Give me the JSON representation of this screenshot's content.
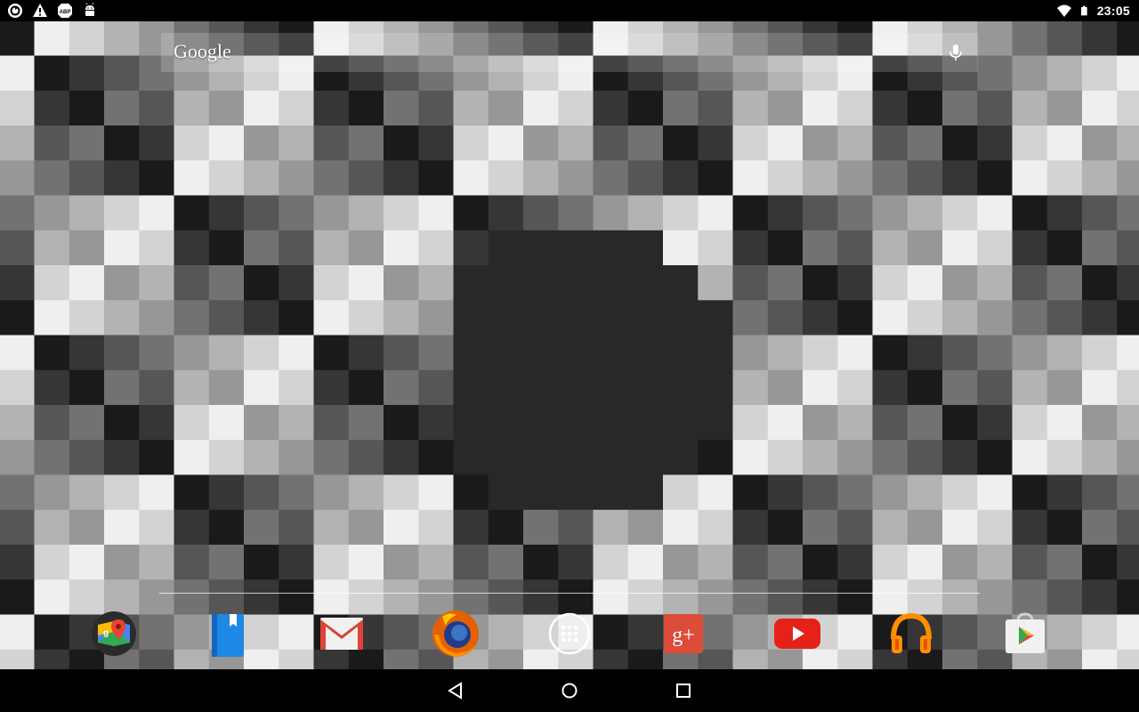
{
  "status_bar": {
    "time": "23:05",
    "left_icons": [
      "sync-icon",
      "warning-icon",
      "adblock-icon",
      "android-debug-icon"
    ],
    "right_icons": [
      "wifi-icon",
      "battery-icon"
    ]
  },
  "search_bar": {
    "logo_text": "Google",
    "icon": "mic-icon"
  },
  "dock": {
    "apps": [
      {
        "name": "Maps",
        "icon": "maps-icon"
      },
      {
        "name": "Play Books",
        "icon": "books-icon"
      },
      {
        "name": "Gmail",
        "icon": "gmail-icon"
      },
      {
        "name": "Firefox",
        "icon": "firefox-icon"
      },
      {
        "name": "All Apps",
        "icon": "app-drawer-icon"
      },
      {
        "name": "Google+",
        "icon": "google-plus-icon",
        "label": "g+"
      },
      {
        "name": "YouTube",
        "icon": "youtube-icon"
      },
      {
        "name": "Play Music",
        "icon": "headphones-icon"
      },
      {
        "name": "Play Store",
        "icon": "play-store-icon"
      }
    ]
  },
  "nav_bar": {
    "buttons": [
      "back-icon",
      "home-icon",
      "recents-icon"
    ]
  },
  "colors": {
    "gmail_red": "#db4437",
    "gplus_red": "#dd4b39",
    "youtube_red": "#e62117",
    "books_blue": "#1e88e5",
    "music_orange": "#ff8f00",
    "firefox_orange": "#e66000",
    "firefox_blue": "#1f3c8c"
  }
}
